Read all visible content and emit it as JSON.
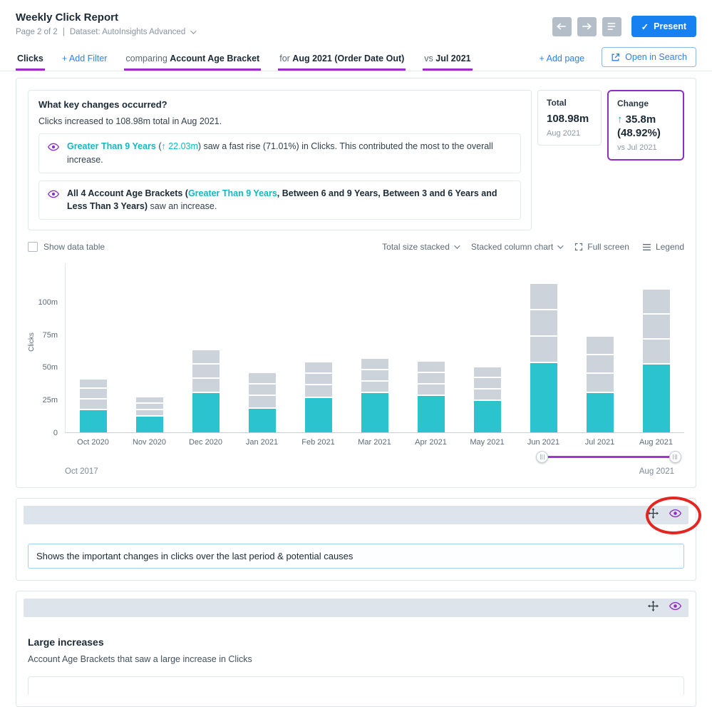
{
  "header": {
    "title": "Weekly Click Report",
    "page_info": "Page 2 of 2",
    "separator": "|",
    "dataset": "Dataset: AutoInsights Advanced",
    "present_check": "✓",
    "present_label": "Present"
  },
  "filter_bar": {
    "metric": "Clicks",
    "add_filter": "+ Add Filter",
    "comparing_prefix": "comparing ",
    "comparing_value": "Account Age Bracket",
    "for_prefix": "for ",
    "for_value": "Aug 2021 (Order Date Out)",
    "vs_prefix": "vs ",
    "vs_value": "Jul 2021",
    "add_page": "+ Add page",
    "open_in_search": "Open in Search"
  },
  "insights": {
    "question": "What key changes occurred?",
    "summary": "Clicks increased to 108.98m total in Aug 2021.",
    "item1": {
      "highlight": "Greater Than 9 Years",
      "open_paren": " (",
      "delta": "↑ 22.03m",
      "rest": ") saw a fast rise (71.01%) in Clicks. This contributed the most to the overall increase."
    },
    "item2": {
      "prefix": "All 4 Account Age Brackets (",
      "highlight": "Greater Than 9 Years",
      "others": ", Between 6 and 9 Years, Between 3 and 6 Years and Less Than 3 Years)",
      "suffix": " saw an increase."
    }
  },
  "summary_cards": {
    "total": {
      "label": "Total",
      "value": "108.98m",
      "period": "Aug 2021"
    },
    "change": {
      "label": "Change",
      "arrow": "↑",
      "value": "35.8m",
      "percent": "(48.92%)",
      "period": "vs Jul 2021"
    }
  },
  "chart_controls": {
    "show_data_table": "Show data table",
    "size_mode": "Total size stacked",
    "chart_type": "Stacked column chart",
    "full_screen": "Full screen",
    "legend": "Legend"
  },
  "chart_data": {
    "type": "bar",
    "stacked": true,
    "title": "",
    "ylabel": "Clicks",
    "categories": [
      "Oct 2020",
      "Nov 2020",
      "Dec 2020",
      "Jan 2021",
      "Feb 2021",
      "Mar 2021",
      "Apr 2021",
      "May 2021",
      "Jun 2021",
      "Jul 2021",
      "Aug 2021"
    ],
    "series": [
      {
        "name": "Greater Than 9 Years",
        "color": "#2bc3cd",
        "values": [
          17,
          12,
          30,
          18,
          26,
          30,
          28,
          24,
          53,
          30,
          52
        ]
      },
      {
        "name": "Between 6 and 9 Years",
        "color": "#ccd3da",
        "values": [
          8,
          5,
          11,
          10,
          10,
          9,
          9,
          9,
          20,
          15,
          19
        ]
      },
      {
        "name": "Between 3 and 6 Years",
        "color": "#ccd3da",
        "values": [
          8,
          5,
          11,
          9,
          9,
          9,
          9,
          9,
          20,
          14,
          19
        ]
      },
      {
        "name": "Less Than 3 Years",
        "color": "#ccd3da",
        "values": [
          7,
          5,
          11,
          9,
          9,
          9,
          9,
          8,
          20,
          14,
          19
        ]
      }
    ],
    "ylim": [
      0,
      130
    ],
    "yticks": [
      {
        "v": 0,
        "label": "0"
      },
      {
        "v": 25,
        "label": "25m"
      },
      {
        "v": 50,
        "label": "50m"
      },
      {
        "v": 75,
        "label": "75m"
      },
      {
        "v": 100,
        "label": "100m"
      }
    ],
    "grid": false,
    "legend_position": "hidden"
  },
  "time_slider": {
    "start_label": "Oct 2017",
    "end_label": "Aug 2021",
    "selection_start_pct": 77,
    "selection_end_pct": 98.5
  },
  "section_summary": {
    "note": "Shows the important changes in clicks over the last period & potential causes"
  },
  "section_large": {
    "title": "Large increases",
    "subtitle": "Account Age Brackets that saw a large increase in Clicks"
  },
  "colors": {
    "accent_purple": "#8e2ec6",
    "teal": "#0fb8c4",
    "blue": "#1781f2",
    "bar_gray": "#ccd3da"
  }
}
